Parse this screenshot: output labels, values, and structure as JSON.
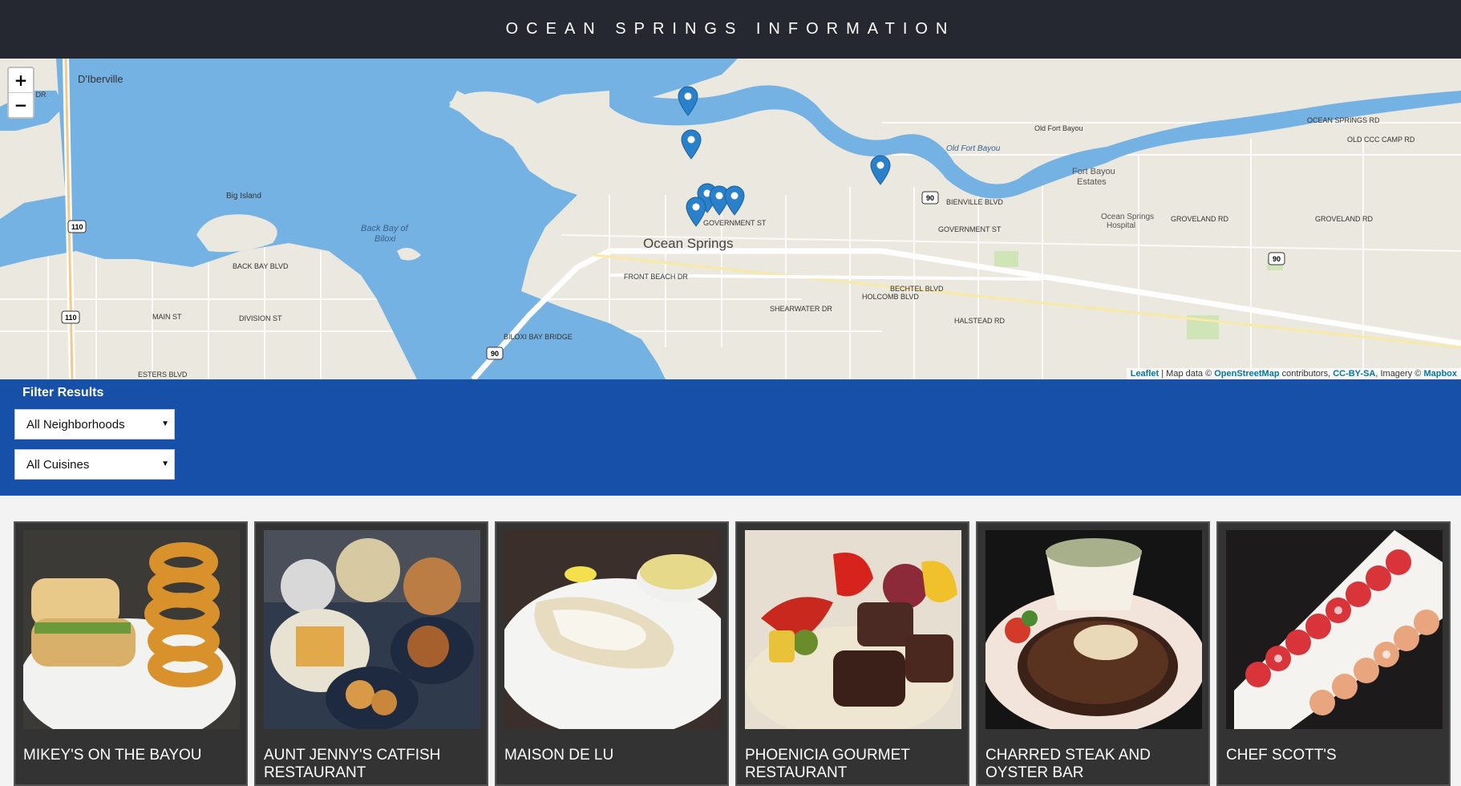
{
  "header": {
    "title": "OCEAN SPRINGS INFORMATION"
  },
  "map": {
    "zoom_in_label": "+",
    "zoom_out_label": "−",
    "labels": {
      "diberville": "D'Iberville",
      "big_island": "Big Island",
      "back_bay_1": "Back Bay of",
      "back_bay_2": "Biloxi",
      "ocean_springs": "Ocean Springs",
      "fort_bayou_1": "Fort Bayou",
      "fort_bayou_2": "Estates",
      "hospital_1": "Ocean Springs",
      "hospital_2": "Hospital",
      "old_fort_bayou": "Old Fort Bayou",
      "bienville_blvd": "BIENVILLE BLVD",
      "government_st": "GOVERNMENT ST",
      "front_beach_dr": "FRONT BEACH DR",
      "division_st": "DIVISION ST",
      "groveland_rd": "GROVELAND RD",
      "ocean_springs_rd": "OCEAN SPRINGS RD",
      "old_ccc_camp_rd": "OLD CCC CAMP RD",
      "holcomb_blvd": "HOLCOMB BLVD",
      "bechtel_blvd": "BECHTEL BLVD",
      "esters_blvd": "ESTERS BLVD",
      "back_bay_blvd": "BACK BAY BLVD",
      "biloxi_bay_bridge": "BILOXI BAY BRIDGE",
      "shearwater_dr": "SHEARWATER DR",
      "halstead_rd": "HALSTEAD RD",
      "main_st": "MAIN ST",
      "shore_dr": "SHORE DR",
      "i110": "110",
      "us90": "90"
    },
    "attribution": {
      "leaflet": "Leaflet",
      "text1": " | Map data © ",
      "osm": "OpenStreetMap",
      "text2": " contributors, ",
      "license": "CC-BY-SA",
      "text3": ", Imagery © ",
      "mapbox": "Mapbox"
    },
    "marker_color": "#2a81cb"
  },
  "filter": {
    "title": "Filter Results",
    "neighborhood_select": "All Neighborhoods",
    "cuisine_select": "All Cuisines"
  },
  "restaurants": [
    {
      "name": "MIKEY'S ON THE BAYOU"
    },
    {
      "name": "AUNT JENNY'S CATFISH RESTAURANT"
    },
    {
      "name": "MAISON DE LU"
    },
    {
      "name": "PHOENICIA GOURMET RESTAURANT"
    },
    {
      "name": "CHARRED STEAK AND OYSTER BAR"
    },
    {
      "name": "CHEF SCOTT'S"
    }
  ],
  "colors": {
    "header_bg": "#252831",
    "filter_bg": "#1650a8",
    "card_bg": "#333333",
    "water": "#73b2e3",
    "land": "#ebe8df"
  }
}
